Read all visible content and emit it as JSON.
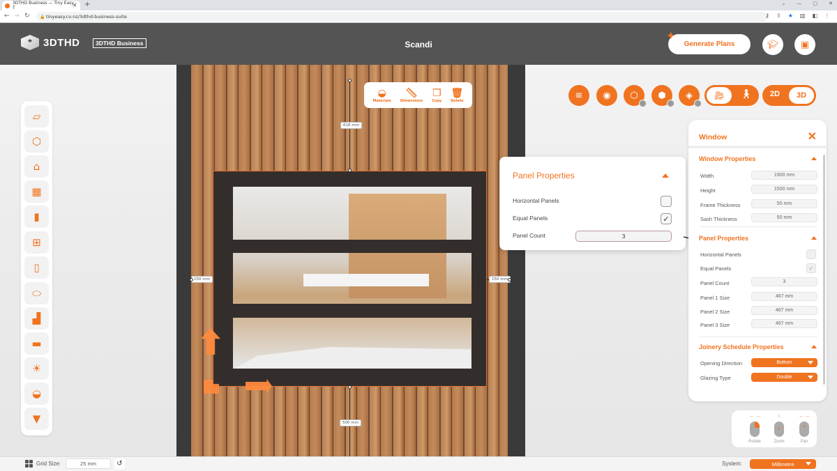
{
  "browser": {
    "tab_title": "3DTHD Business — Tiny Easy - T",
    "url": "tinyeasy.co.nz/3dthd-business-suite"
  },
  "header": {
    "logo_text": "3DTHD",
    "badge": "3DTHD Business",
    "project_title": "Scandi",
    "generate_label": "Generate Plans"
  },
  "left_toolbar": {
    "items": [
      {
        "name": "floor-base",
        "glyph": "⏥"
      },
      {
        "name": "walls",
        "glyph": "⬡"
      },
      {
        "name": "roof",
        "glyph": "⌂"
      },
      {
        "name": "deck",
        "glyph": "▦"
      },
      {
        "name": "doors",
        "glyph": "▮"
      },
      {
        "name": "windows",
        "glyph": "⊞"
      },
      {
        "name": "panels",
        "glyph": "▯"
      },
      {
        "name": "floor",
        "glyph": "⬭"
      },
      {
        "name": "stairs",
        "glyph": "▟"
      },
      {
        "name": "furniture",
        "glyph": "▬"
      },
      {
        "name": "lighting",
        "glyph": "☀"
      },
      {
        "name": "paint",
        "glyph": "◒"
      },
      {
        "name": "bookmark",
        "glyph": "▼"
      }
    ]
  },
  "object_toolbar": {
    "materials": "Materials",
    "dimensions": "Dimensions",
    "copy": "Copy",
    "delete": "Delete"
  },
  "dimensions": {
    "top": "616 mm",
    "bottom": "500 mm",
    "left": "150 mm",
    "right": "150 mm"
  },
  "view_toggles": {
    "mode_2d": "2D",
    "mode_3d": "3D",
    "active_mode": "3D",
    "active_camera": "orbit-camera"
  },
  "panel_popup": {
    "title": "Panel Properties",
    "horizontal_panels_label": "Horizontal Panels",
    "horizontal_panels_checked": false,
    "equal_panels_label": "Equal Panels",
    "equal_panels_checked": true,
    "panel_count_label": "Panel Count",
    "panel_count_value": "3"
  },
  "side_panel": {
    "title": "Window",
    "window_properties": {
      "heading": "Window Properties",
      "width_label": "Width",
      "width_value": "1900 mm",
      "height_label": "Height",
      "height_value": "1500 mm",
      "frame_label": "Frame Thickness",
      "frame_value": "50 mm",
      "sash_label": "Sash Thickness",
      "sash_value": "50 mm"
    },
    "panel_properties": {
      "heading": "Panel Properties",
      "horizontal_label": "Horizontal Panels",
      "equal_label": "Equal Panels",
      "count_label": "Panel Count",
      "count_value": "3",
      "p1_label": "Panel 1 Size",
      "p1_value": "467 mm",
      "p2_label": "Panel 2 Size",
      "p2_value": "467 mm",
      "p3_label": "Panel 3 Size",
      "p3_value": "467 mm"
    },
    "joinery": {
      "heading": "Joinery Schedule Properties",
      "opening_label": "Opening Direction",
      "opening_value": "Bottom",
      "glazing_label": "Glazing Type",
      "glazing_value": "Double"
    }
  },
  "mouse_help": {
    "rotate": "Rotate",
    "zoom": "Zoom",
    "pan": "Pan"
  },
  "bottom_bar": {
    "grid_label": "Grid Size:",
    "grid_value": "25 mm",
    "system_label": "System:",
    "system_value": "Millimetre"
  },
  "colors": {
    "accent": "#f07320",
    "topbar": "#545454"
  }
}
